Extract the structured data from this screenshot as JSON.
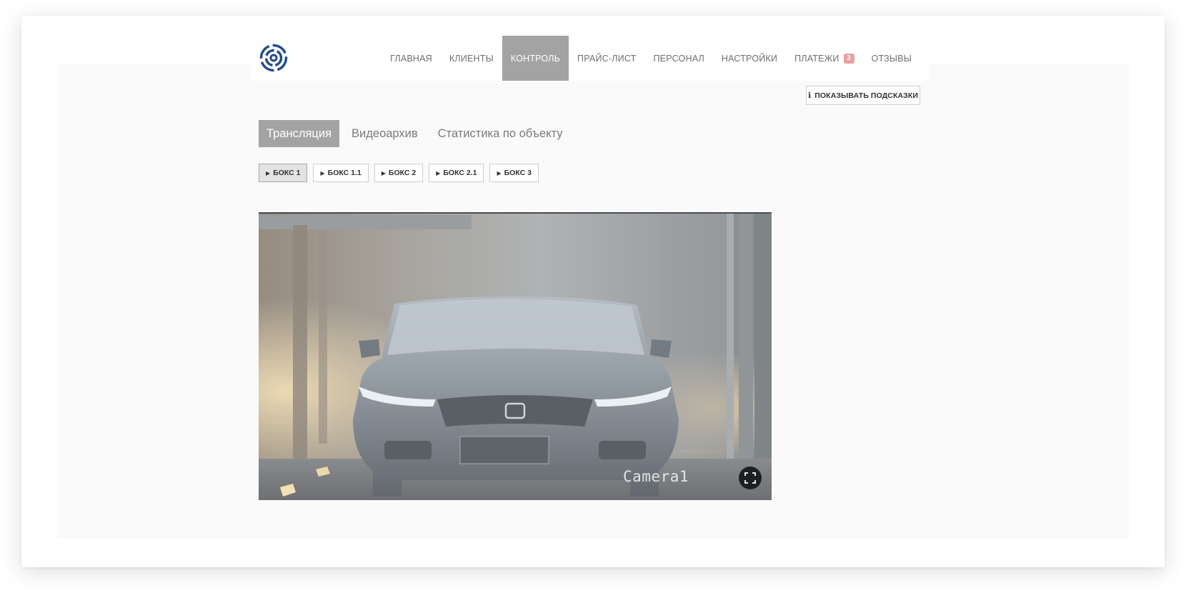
{
  "nav": {
    "items": [
      {
        "label": "ГЛАВНАЯ",
        "active": false
      },
      {
        "label": "КЛИЕНТЫ",
        "active": false
      },
      {
        "label": "КОНТРОЛЬ",
        "active": true
      },
      {
        "label": "ПРАЙС-ЛИСТ",
        "active": false
      },
      {
        "label": "ПЕРСОНАЛ",
        "active": false
      },
      {
        "label": "НАСТРОЙКИ",
        "active": false
      },
      {
        "label": "ПЛАТЕЖИ",
        "active": false,
        "badge": "3"
      },
      {
        "label": "ОТЗЫВЫ",
        "active": false
      }
    ]
  },
  "hints": {
    "icon": "info-icon",
    "glyph": "ℹ",
    "label": "ПОКАЗЫВАТЬ ПОДСКАЗКИ"
  },
  "tabs": [
    {
      "label": "Трансляция",
      "active": true
    },
    {
      "label": "Видеоархив",
      "active": false
    },
    {
      "label": "Статистика по объекту",
      "active": false
    }
  ],
  "boxes": [
    {
      "label": "БОКС 1",
      "active": true
    },
    {
      "label": "БОКС 1.1",
      "active": false
    },
    {
      "label": "БОКС 2",
      "active": false
    },
    {
      "label": "БОКС 2.1",
      "active": false
    },
    {
      "label": "БОКС 3",
      "active": false
    }
  ],
  "video": {
    "camera_label": "Camera1",
    "fullscreen_icon": "fullscreen-icon"
  },
  "colors": {
    "logo": "#1f4b8c",
    "active_tab": "#a3a3a3",
    "badge": "#e8a0a0"
  }
}
